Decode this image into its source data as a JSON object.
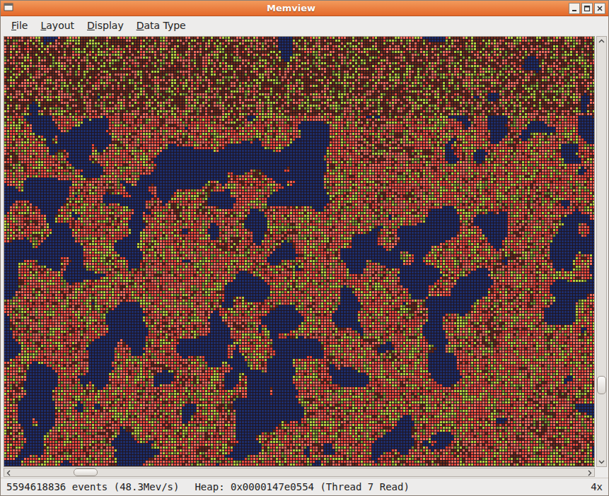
{
  "window": {
    "title": "Memview"
  },
  "menu": [
    {
      "label": "File"
    },
    {
      "label": "Layout"
    },
    {
      "label": "Display"
    },
    {
      "label": "Data Type"
    }
  ],
  "memory_map": {
    "cell_kinds": [
      {
        "kind": "free",
        "color": "#1b2d6b"
      },
      {
        "kind": "read",
        "color": "#ea4a3c"
      },
      {
        "kind": "recent-read",
        "color": "#f46e5c"
      },
      {
        "kind": "write",
        "color": "#b6cf3e"
      },
      {
        "kind": "old-write",
        "color": "#7e9a32"
      },
      {
        "kind": "stale",
        "color": "#6e2c1a"
      }
    ]
  },
  "scroll": {
    "vertical": 0.84,
    "horizontal": 0.11
  },
  "status_bar": {
    "events": "5594618836 events (48.3Mev/s)",
    "heap": "Heap: 0x0000147e0554 (Thread 7 Read)",
    "zoom": "4x"
  }
}
